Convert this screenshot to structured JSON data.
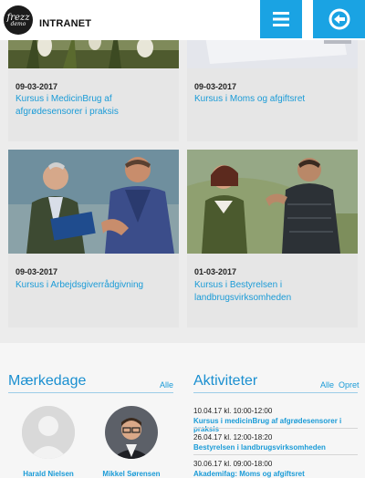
{
  "header": {
    "logo_line1": "frezz",
    "logo_line2": "demo",
    "brand": "INTRANET",
    "menu_icon": "hamburger-icon",
    "back_icon": "arrow-left-circle-icon",
    "accent": "#1aa3e3"
  },
  "cards": [
    {
      "date": "09-03-2017",
      "title": "Kursus i MedicinBrug af afgrødesensorer i praksis"
    },
    {
      "date": "09-03-2017",
      "title": "Kursus i Moms og afgiftsret"
    },
    {
      "date": "09-03-2017",
      "title": "Kursus i Arbejdsgiverrådgivning"
    },
    {
      "date": "01-03-2017",
      "title": "Kursus i Bestyrelsen i landbrugsvirksomheden"
    }
  ],
  "birthdays": {
    "title": "Mærkedage",
    "all_label": "Alle",
    "people": [
      {
        "name": "Harald Nielsen",
        "avatar_icon": "default-person-icon"
      },
      {
        "name": "Mikkel Sørensen",
        "avatar_icon": "person-photo"
      }
    ]
  },
  "activities": {
    "title": "Aktiviteter",
    "all_label": "Alle",
    "create_label": "Opret",
    "items": [
      {
        "time": "10.04.17 kl. 10:00-12:00",
        "name": "Kursus i medicinBrug af afgrødesensorer i praksis"
      },
      {
        "time": "26.04.17 kl. 12:00-18:20",
        "name": "Bestyrelsen i landbrugsvirksomheden"
      },
      {
        "time": "30.06.17 kl. 09:00-18:00",
        "name": "Akademifag: Moms og afgiftsret"
      }
    ]
  }
}
